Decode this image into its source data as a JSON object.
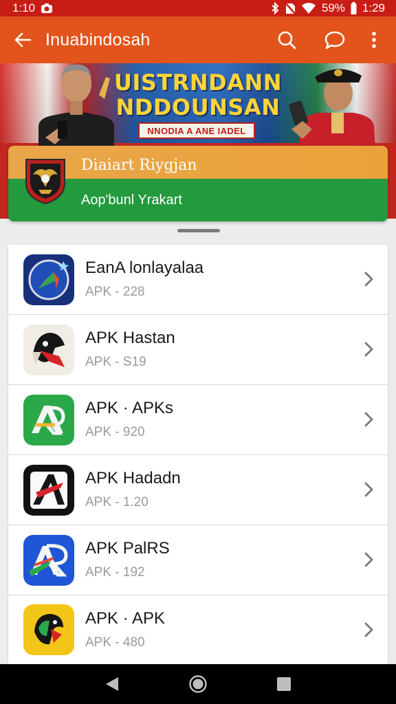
{
  "status_bar": {
    "time": "1:10",
    "battery": "59%",
    "clock_right": "1:29",
    "icons": [
      "camera-icon",
      "bluetooth-icon",
      "no-sim-icon",
      "wifi-icon",
      "battery-icon"
    ]
  },
  "app_bar": {
    "title": "Inuabindosah",
    "icons": [
      "back-arrow-icon",
      "search-icon",
      "chat-icon",
      "more-vert-icon"
    ]
  },
  "banner": {
    "headline_line1": "UISTRNDANN",
    "headline_line2": "NDDOUNSAN",
    "subtitle": "NNODIA A ANE IADEL"
  },
  "featured_card": {
    "title": "Diaiart Riygjan",
    "subtitle": "Aop'bunl Yrakart"
  },
  "apps": [
    {
      "name": "EanA lonlayalaa",
      "meta": "APK - 228",
      "icon": "compass-app-icon"
    },
    {
      "name": "APK Hastan",
      "meta": "APK - S19",
      "icon": "eagle-app-icon"
    },
    {
      "name": "APK · APKs",
      "meta": "APK - 920",
      "icon": "green-a-app-icon"
    },
    {
      "name": "APK Hadadn",
      "meta": "APK - 1.20",
      "icon": "black-a-app-icon"
    },
    {
      "name": "APK PalRS",
      "meta": "APK - 192",
      "icon": "blue-ar-app-icon"
    },
    {
      "name": "APK · APK",
      "meta": "APK - 480",
      "icon": "yellow-bird-app-icon"
    }
  ],
  "colors": {
    "status_bar": "#c81d14",
    "app_bar": "#e2541c",
    "card_orange": "#eaa13a",
    "card_green": "#239a3d"
  }
}
